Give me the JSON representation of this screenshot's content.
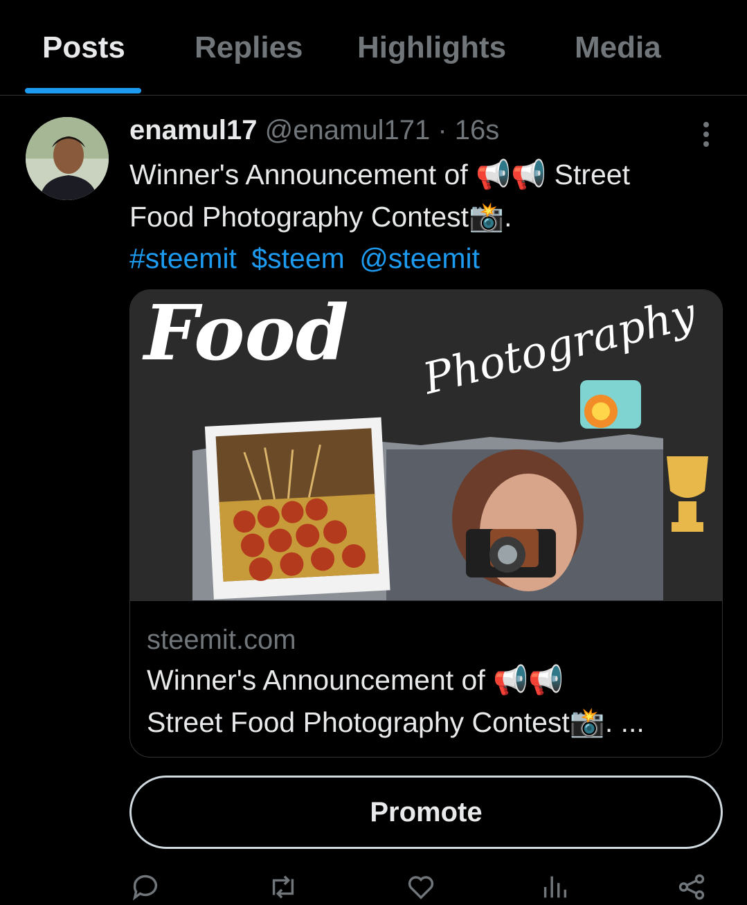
{
  "tabs": [
    {
      "label": "Posts",
      "active": true
    },
    {
      "label": "Replies",
      "active": false
    },
    {
      "label": "Highlights",
      "active": false
    },
    {
      "label": "Media",
      "active": false
    }
  ],
  "post": {
    "display_name": "enamul17",
    "handle": "@enamul171",
    "separator": "·",
    "time": "16s",
    "text_line1": "Winner's Announcement of 📢📢 Street",
    "text_line2": "Food Photography Contest📸.",
    "hashtags": [
      "#steemit",
      "$steem",
      "@steemit"
    ]
  },
  "card": {
    "domain": "steemit.com",
    "title_line1": "Winner's Announcement of 📢📢",
    "title_line2": "Street Food Photography Contest📸. ...",
    "image_text_food": "Food",
    "image_text_photography": "Photography"
  },
  "promote_label": "Promote",
  "actions": [
    "reply-icon",
    "repost-icon",
    "like-icon",
    "views-icon",
    "share-icon"
  ],
  "colors": {
    "accent": "#1d9bf0",
    "background": "#000000",
    "muted": "#71767b",
    "text": "#e7e9ea"
  }
}
